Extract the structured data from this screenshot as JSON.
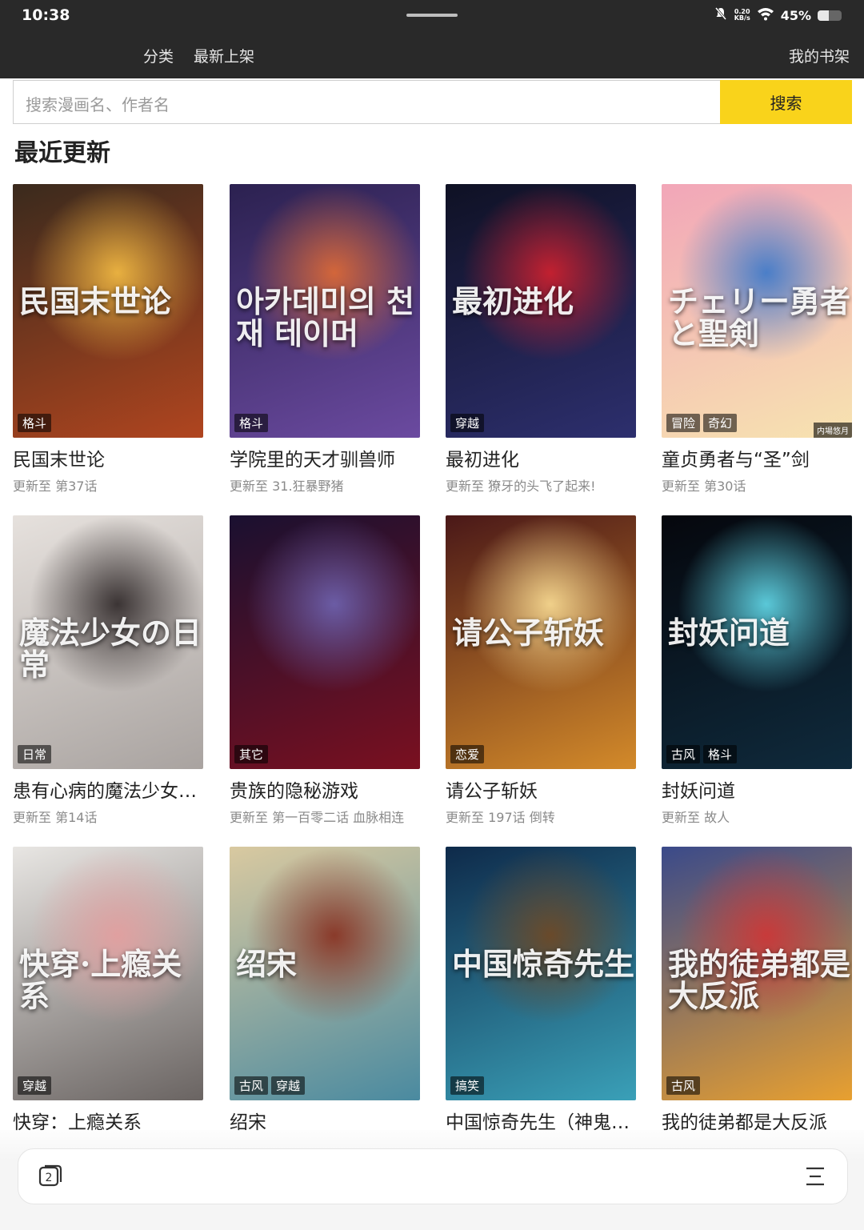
{
  "status": {
    "time": "10:38",
    "net_speed": "0.20",
    "net_unit": "KB/s",
    "battery": "45%",
    "battery_level": 0.45
  },
  "nav": {
    "category": "分类",
    "latest": "最新上架",
    "bookshelf": "我的书架"
  },
  "search": {
    "placeholder": "搜索漫画名、作者名",
    "button": "搜索"
  },
  "section": {
    "title": "最近更新"
  },
  "comics": [
    {
      "title": "民国末世论",
      "update": "更新至 第37话",
      "tags": [
        "格斗"
      ],
      "cover_text": "民国末世论",
      "colors": [
        "#3a2a1d",
        "#b0451f",
        "#e8b040"
      ]
    },
    {
      "title": "学院里的天才驯兽师",
      "update": "更新至 31.狂暴野猪",
      "tags": [
        "格斗"
      ],
      "cover_text": "아카데미의 천재 테이머",
      "colors": [
        "#2b2150",
        "#6b4aa0",
        "#d3663a"
      ]
    },
    {
      "title": "最初进化",
      "update": "更新至 獠牙的头飞了起来!",
      "tags": [
        "穿越"
      ],
      "cover_text": "最初进化",
      "colors": [
        "#0f1124",
        "#2d2f6e",
        "#c22030"
      ]
    },
    {
      "title": "童贞勇者与“圣”剑",
      "update": "更新至 第30话",
      "tags": [
        "冒险",
        "奇幻"
      ],
      "cover_text": "チェリー勇者と聖剣",
      "corner": "内場悠月",
      "colors": [
        "#f2a6b8",
        "#f7e3b0",
        "#4a7ec8"
      ]
    },
    {
      "title": "患有心病的魔法少女的日常",
      "update": "更新至 第14话",
      "tags": [
        "日常"
      ],
      "cover_text": "魔法少女の日常",
      "colors": [
        "#e6e1dd",
        "#a9a3a0",
        "#3b3434"
      ]
    },
    {
      "title": "贵族的隐秘游戏",
      "update": "更新至 第一百零二话 血脉相连",
      "tags": [
        "其它"
      ],
      "cover_text": "",
      "colors": [
        "#1a1030",
        "#7a1020",
        "#6b5ca5"
      ]
    },
    {
      "title": "请公子斩妖",
      "update": "更新至 197话 倒转",
      "tags": [
        "恋爱"
      ],
      "cover_text": "请公子斩妖",
      "colors": [
        "#4a1818",
        "#d38a2a",
        "#f0d08a"
      ]
    },
    {
      "title": "封妖问道",
      "update": "更新至 故人",
      "tags": [
        "古风",
        "格斗"
      ],
      "cover_text": "封妖问道",
      "colors": [
        "#05070d",
        "#0f2a3c",
        "#5ac8d8"
      ]
    },
    {
      "title": "快穿：上瘾关系",
      "update": "",
      "tags": [
        "穿越"
      ],
      "cover_text": "快穿·上瘾关系",
      "colors": [
        "#e8e6e3",
        "#6a6462",
        "#e0a0a0"
      ]
    },
    {
      "title": "绍宋",
      "update": "",
      "tags": [
        "古风",
        "穿越"
      ],
      "cover_text": "绍宋",
      "colors": [
        "#d9c9a0",
        "#4a8aa0",
        "#8a3a2a"
      ]
    },
    {
      "title": "中国惊奇先生（神鬼七杀令）",
      "update": "",
      "tags": [
        "搞笑"
      ],
      "cover_text": "中国惊奇先生",
      "colors": [
        "#0e2a4a",
        "#3aa0b8",
        "#6a4a2a"
      ]
    },
    {
      "title": "我的徒弟都是大反派",
      "update": "",
      "tags": [
        "古风"
      ],
      "cover_text": "我的徒弟都是大反派",
      "colors": [
        "#3a4a8a",
        "#e8a030",
        "#c83a3a"
      ]
    }
  ],
  "bottom": {
    "tab_count": "2"
  }
}
